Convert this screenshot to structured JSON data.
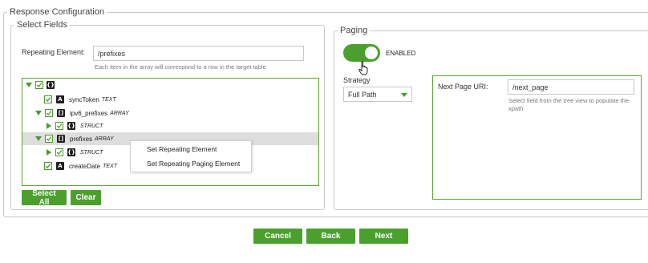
{
  "response_config": {
    "legend": "Response Configuration",
    "select_fields": {
      "legend": "Select Fields",
      "repeating_label": "Repeating Element:",
      "repeating_value": "/prefixes",
      "repeating_hint": "Each item in the array will correspond to a row in the target table",
      "tree": [
        {
          "badge": "{}",
          "name": "",
          "type": ""
        },
        {
          "badge": "A",
          "name": "syncToken",
          "type": "TEXT"
        },
        {
          "badge": "[]",
          "name": "ipv6_prefixes",
          "type": "ARRAY"
        },
        {
          "badge": "{}",
          "name": "",
          "type": "STRUCT"
        },
        {
          "badge": "[]",
          "name": "prefixes",
          "type": "ARRAY"
        },
        {
          "badge": "{}",
          "name": "",
          "type": "STRUCT"
        },
        {
          "badge": "A",
          "name": "createDate",
          "type": "TEXT"
        }
      ],
      "context_menu": [
        "Set Repeating Element",
        "Set Repeating Paging Element"
      ],
      "select_all_label": "Select All",
      "clear_label": "Clear"
    },
    "paging": {
      "legend": "Paging",
      "toggle_label": "ENABLED",
      "toggle_on": true,
      "strategy_label": "Strategy",
      "strategy_value": "Full Path",
      "next_page_label": "Next Page URI:",
      "next_page_value": "/next_page",
      "next_page_hint_1": "Select field from the tree view to populate the",
      "next_page_hint_2": "xpath"
    }
  },
  "footer": {
    "cancel_label": "Cancel",
    "back_label": "Back",
    "next_label": "Next"
  },
  "colors": {
    "accent": "#4ba02d",
    "accent_border": "#5aa633"
  }
}
